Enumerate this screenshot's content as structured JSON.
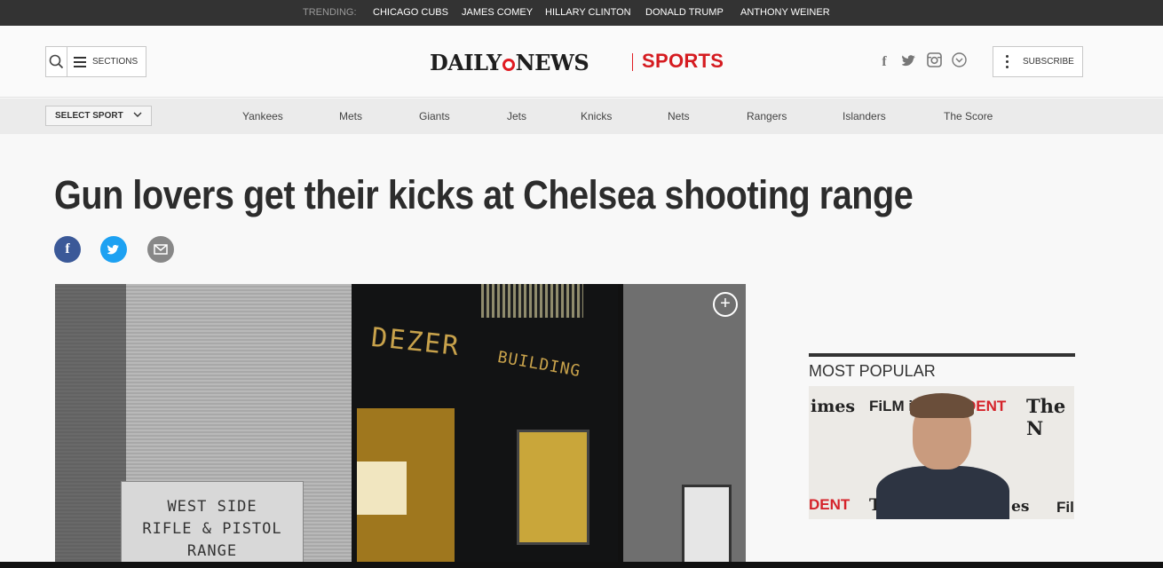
{
  "trending": {
    "label": "TRENDING:",
    "items": [
      "CHICAGO CUBS",
      "JAMES COMEY",
      "HILLARY CLINTON",
      "DONALD TRUMP",
      "ANTHONY WEINER"
    ]
  },
  "header": {
    "sections_label": "SECTIONS",
    "logo_left": "DAILY",
    "logo_right": "NEWS",
    "section_name": "SPORTS",
    "subscribe_label": "SUBSCRIBE",
    "social": [
      "facebook-icon",
      "twitter-icon",
      "instagram-icon",
      "chevron-down-icon"
    ]
  },
  "sport_nav": {
    "select_label": "SELECT SPORT",
    "items": [
      "Yankees",
      "Mets",
      "Giants",
      "Jets",
      "Knicks",
      "Nets",
      "Rangers",
      "Islanders",
      "The Score"
    ]
  },
  "article": {
    "headline": "Gun lovers get their kicks at Chelsea shooting range",
    "share": [
      "facebook-share",
      "twitter-share",
      "email-share"
    ],
    "photo": {
      "plaque_lines": [
        "WEST SIDE",
        "RIFLE & PISTOL",
        "RANGE"
      ],
      "sign_left": "DEZER",
      "sign_right": "BUILDING"
    }
  },
  "sidebar": {
    "most_popular_title": "MOST POPULAR",
    "image_texts": [
      "imes",
      "FiLM iN",
      "DENT",
      "The N",
      "DENT",
      "Th",
      "es",
      "Fil"
    ]
  },
  "colors": {
    "brand_red": "#d51b20",
    "facebook": "#3b5998",
    "twitter": "#1da1f2",
    "email": "#888888"
  }
}
